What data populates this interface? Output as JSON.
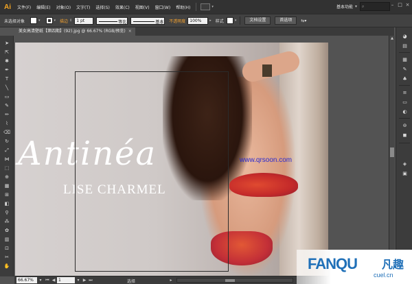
{
  "app": {
    "logo": "Ai",
    "menu": [
      "文件(F)",
      "编辑(E)",
      "对象(O)",
      "文字(T)",
      "选择(S)",
      "效果(C)",
      "视图(V)",
      "窗口(W)",
      "帮助(H)"
    ],
    "workspace": "基本功能"
  },
  "control_bar": {
    "selection_label": "未选择对象",
    "stroke_label": "描边",
    "stroke_weight": "1 pt",
    "profile_label": "等比",
    "brush_label": "基本",
    "opacity_label": "不透明度",
    "opacity_value": "100%",
    "style_label": "样式",
    "doc_setup_button": "文档设置",
    "prefs_button": "首选项"
  },
  "document_tab": {
    "title": "美女高清壁纸【第四期】(92).jpg @ 66.67% (RGB/预览)",
    "close": "×"
  },
  "artwork": {
    "brand_script": "Antinéa",
    "brand_sub": "LISE CHARMEL",
    "watermark": "www.qrsoon.com"
  },
  "status_bar": {
    "zoom": "66.67%",
    "page": "1",
    "tool_status": "选择"
  },
  "corner_logo": {
    "text": "FANQU",
    "cn": "凡趣",
    "url": "cuel.cn"
  },
  "colors": {
    "menubar": "#323232",
    "control_bar": "#424242",
    "panel": "#3c3c3c",
    "canvas": "#535353",
    "accent_orange": "#f0a030",
    "logo_blue": "#2070b8"
  }
}
